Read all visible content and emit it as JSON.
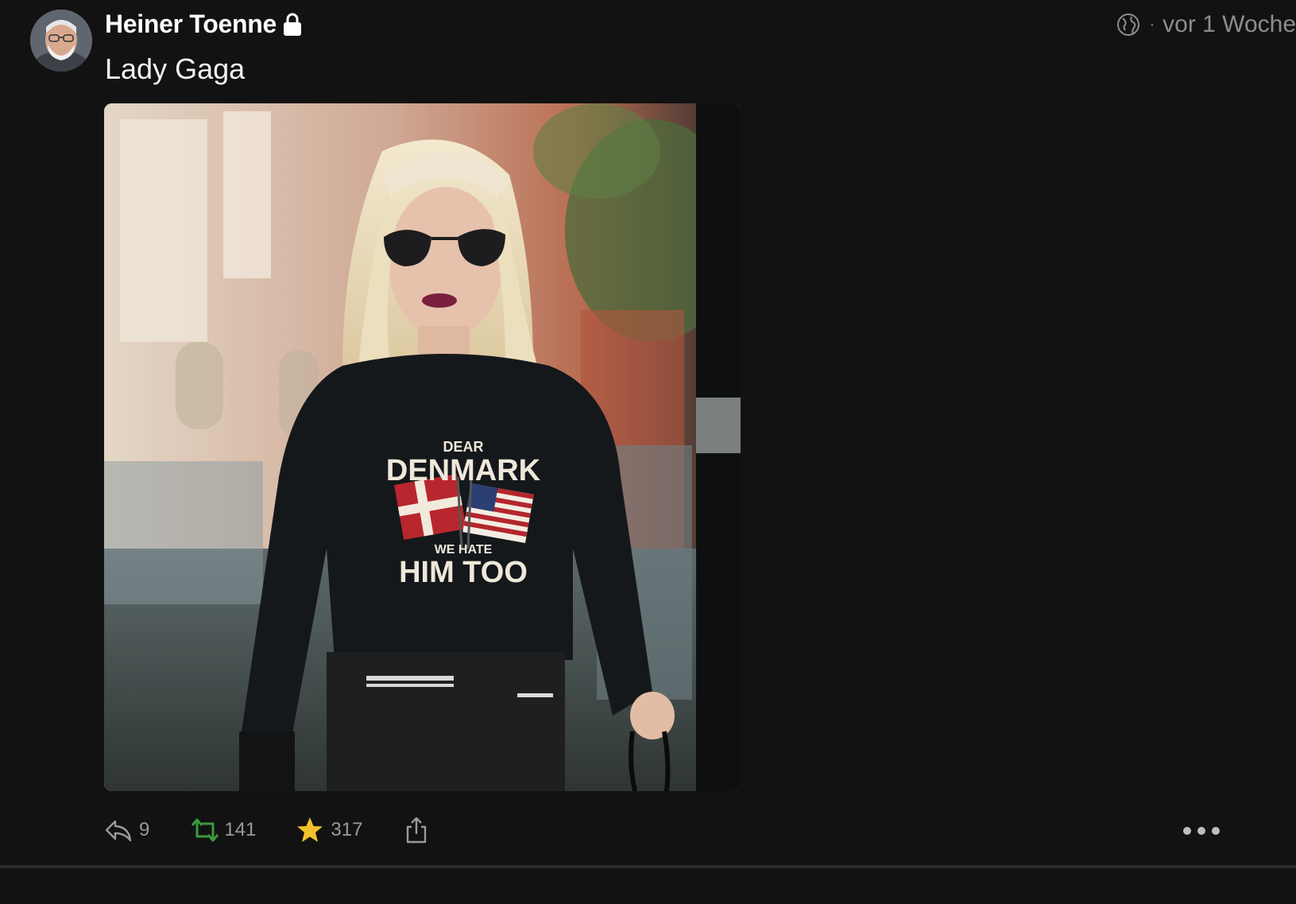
{
  "post": {
    "author_name": "Heiner Toenne",
    "visibility_icon": "globe-icon",
    "time_separator": "·",
    "time": "vor 1 Woche",
    "text": "Lady Gaga",
    "image": {
      "shirt_line1": "DEAR",
      "shirt_line2": "DENMARK",
      "shirt_line3": "WE HATE",
      "shirt_line4": "HIM TOO"
    }
  },
  "actions": {
    "reply_count": "9",
    "boost_count": "141",
    "favourite_count": "317"
  },
  "colors": {
    "background": "#121212",
    "boost_green": "#3a9b3f",
    "star_yellow": "#f2c12e",
    "muted_text": "#9a9a9a"
  }
}
